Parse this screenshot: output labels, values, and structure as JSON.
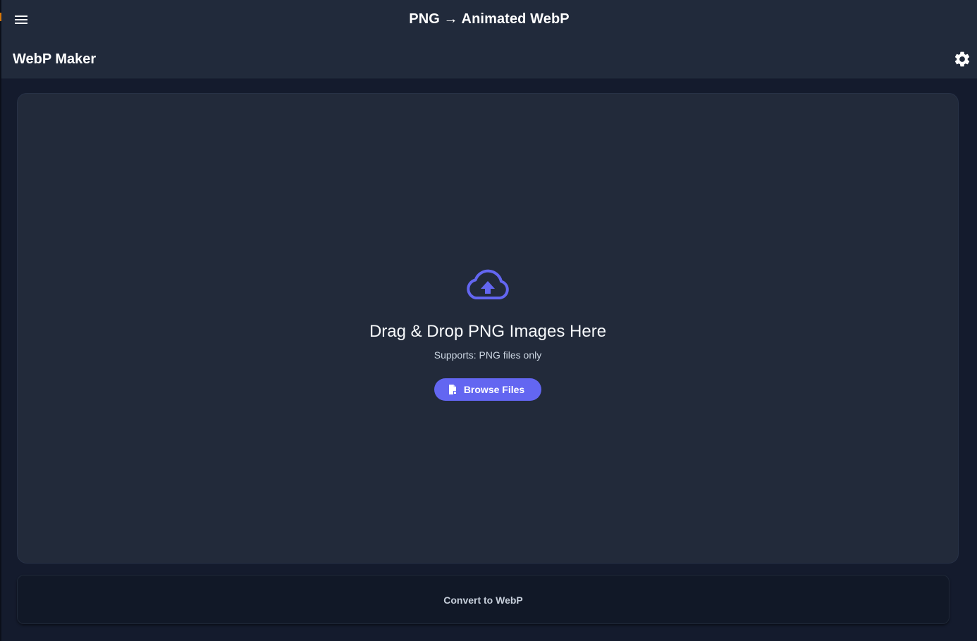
{
  "window": {
    "title": "PNG → Animated WebP"
  },
  "toolbar": {
    "brand": "WebP Maker"
  },
  "dropzone": {
    "title": "Drag & Drop PNG Images Here",
    "subtitle": "Supports: PNG files only",
    "browse_label": "Browse Files"
  },
  "actions": {
    "convert_label": "Convert to WebP"
  },
  "icons": {
    "menu": "hamburger-menu-icon",
    "settings": "gear-icon",
    "upload": "cloud-upload-icon",
    "file": "file-import-icon"
  },
  "colors": {
    "accent": "#6366f1",
    "background": "#141b2d",
    "header": "#212a3b",
    "panel": "#222a3a",
    "button_dark": "#111827"
  }
}
